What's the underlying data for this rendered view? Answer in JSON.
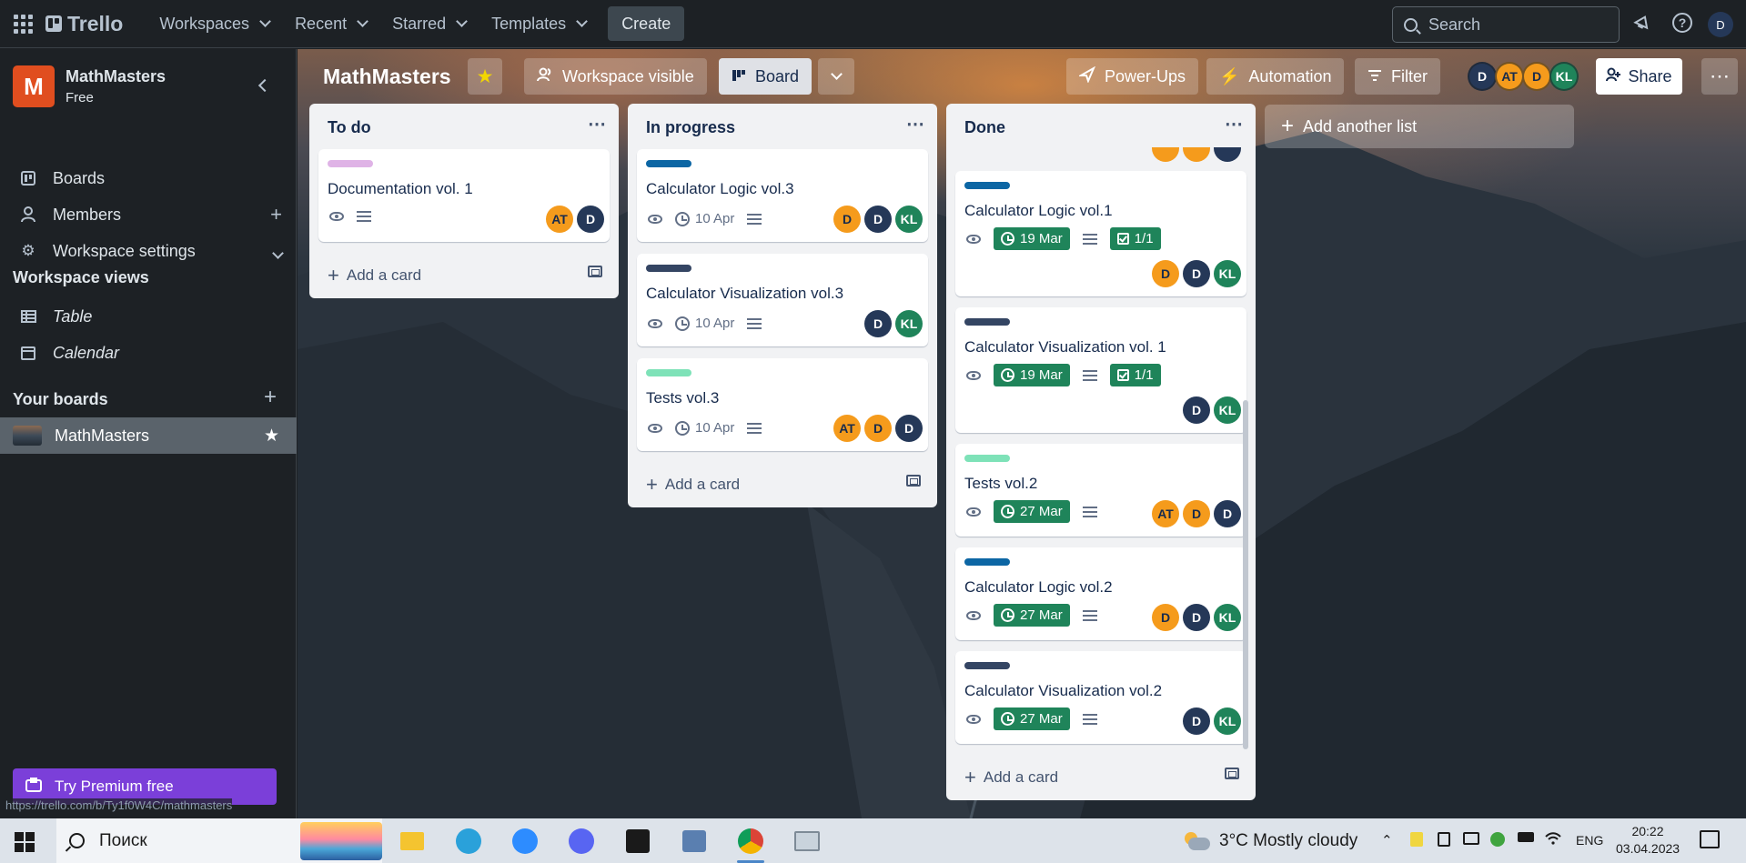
{
  "topnav": {
    "logo": "Trello",
    "menus": [
      "Workspaces",
      "Recent",
      "Starred",
      "Templates"
    ],
    "create": "Create",
    "search_placeholder": "Search",
    "user_initial": "D"
  },
  "sidebar": {
    "workspace_name": "MathMasters",
    "workspace_plan": "Free",
    "workspace_initial": "M",
    "items": [
      {
        "label": "Boards",
        "icon": "trello-board-icon"
      },
      {
        "label": "Members",
        "icon": "person-icon"
      },
      {
        "label": "Workspace settings",
        "icon": "gear-icon"
      }
    ],
    "views_heading": "Workspace views",
    "views": [
      {
        "label": "Table",
        "icon": "table-icon"
      },
      {
        "label": "Calendar",
        "icon": "calendar-icon"
      }
    ],
    "boards_heading": "Your boards",
    "boards": [
      {
        "label": "MathMasters"
      }
    ],
    "premium": "Try Premium free",
    "status_url": "https://trello.com/b/Ty1f0W4C/mathmasters"
  },
  "board": {
    "title": "MathMasters",
    "visibility": "Workspace visible",
    "view": "Board",
    "powerups": "Power-Ups",
    "automation": "Automation",
    "filter": "Filter",
    "members": [
      "D",
      "AT",
      "D",
      "KL"
    ],
    "share": "Share",
    "add_list": "Add another list"
  },
  "lists": [
    {
      "title": "To do",
      "add_card": "Add a card",
      "cards": [
        {
          "title": "Documentation vol. 1",
          "label_color": "#dfb3e6",
          "members": [
            "AT",
            "D"
          ]
        }
      ]
    },
    {
      "title": "In progress",
      "add_card": "Add a card",
      "cards": [
        {
          "title": "Calculator Logic vol.3",
          "label_color": "#0c66a4",
          "due": "10 Apr",
          "members": [
            "D",
            "D",
            "KL"
          ]
        },
        {
          "title": "Calculator Visualization vol.3",
          "label_color": "#344563",
          "due": "10 Apr",
          "members": [
            "D",
            "KL"
          ]
        },
        {
          "title": "Tests vol.3",
          "label_color": "#7ee2b8",
          "due": "10 Apr",
          "members": [
            "AT",
            "D",
            "D"
          ]
        }
      ]
    },
    {
      "title": "Done",
      "add_card": "Add a card",
      "cards": [
        {
          "title": "Calculator Logic vol.1",
          "label_color": "#0c66a4",
          "due": "19 Mar",
          "checklist": "1/1",
          "members": [
            "D",
            "D",
            "KL"
          ]
        },
        {
          "title": "Calculator Visualization vol. 1",
          "label_color": "#344563",
          "due": "19 Mar",
          "checklist": "1/1",
          "members": [
            "D",
            "KL"
          ]
        },
        {
          "title": "Tests vol.2",
          "label_color": "#7ee2b8",
          "due": "27 Mar",
          "members": [
            "AT",
            "D",
            "D"
          ]
        },
        {
          "title": "Calculator Logic vol.2",
          "label_color": "#0c66a4",
          "due": "27 Mar",
          "members": [
            "D",
            "D",
            "KL"
          ]
        },
        {
          "title": "Calculator Visualization vol.2",
          "label_color": "#344563",
          "due": "27 Mar",
          "members": [
            "D",
            "KL"
          ]
        }
      ]
    }
  ],
  "taskbar": {
    "search_placeholder": "Поиск",
    "weather": "3°C  Mostly cloudy",
    "lang": "ENG",
    "time": "20:22",
    "date": "03.04.2023"
  },
  "colors": {
    "orange_avatar": "#f59b1c",
    "navy_avatar": "#253858",
    "green_avatar": "#1f845a",
    "due_green": "#1f845a",
    "premium": "#7b3fd9"
  }
}
